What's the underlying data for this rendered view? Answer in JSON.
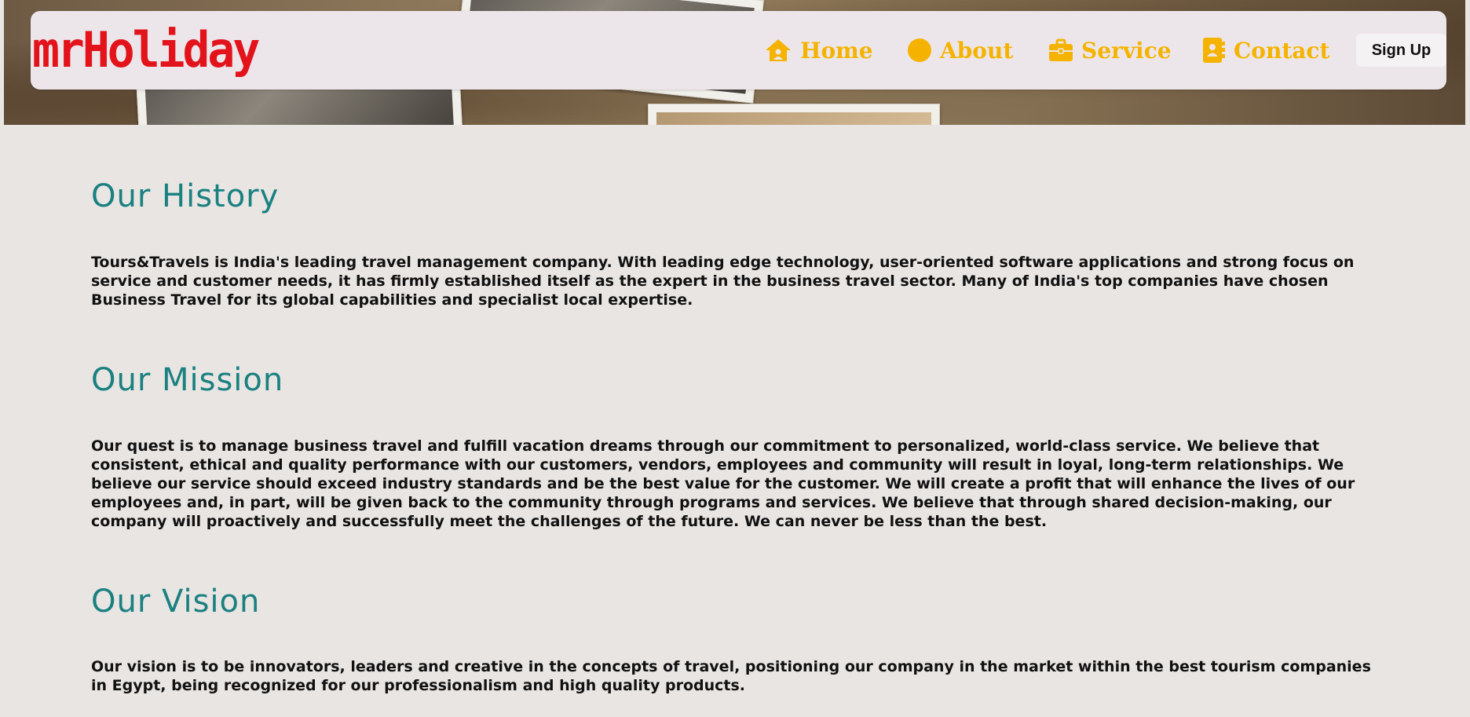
{
  "header": {
    "logo": "mrHoliday",
    "nav": [
      {
        "label": "Home",
        "icon": "home-icon"
      },
      {
        "label": "About",
        "icon": "circle-icon"
      },
      {
        "label": "Service",
        "icon": "briefcase-icon"
      },
      {
        "label": "Contact",
        "icon": "contact-book-icon"
      }
    ],
    "signup_label": "Sign Up"
  },
  "sections": [
    {
      "title": "Our History",
      "text": "Tours&Travels is India's leading travel management company. With leading edge technology, user-oriented software applications and strong focus on service and customer needs, it has firmly established itself as the expert in the business travel sector. Many of India's top companies have chosen Business Travel for its global capabilities and specialist local expertise."
    },
    {
      "title": "Our Mission",
      "text": "Our quest is to manage business travel and fulfill vacation dreams through our commitment to personalized, world-class service. We believe that consistent, ethical and quality performance with our customers, vendors, employees and community will result in loyal, long-term relationships. We believe our service should exceed industry standards and be the best value for the customer. We will create a profit that will enhance the lives of our employees and, in part, will be given back to the community through programs and services. We believe that through shared decision-making, our company will proactively and successfully meet the challenges of the future. We can never be less than the best."
    },
    {
      "title": "Our Vision",
      "text": "Our vision is to be innovators, leaders and creative in the concepts of travel, positioning our company in the market within the best tourism companies in Egypt, being recognized for our professionalism and high quality products."
    }
  ],
  "colors": {
    "logo": "#e3131b",
    "nav": "#f5b300",
    "heading": "#1a8080",
    "background": "#e8e5e3"
  }
}
